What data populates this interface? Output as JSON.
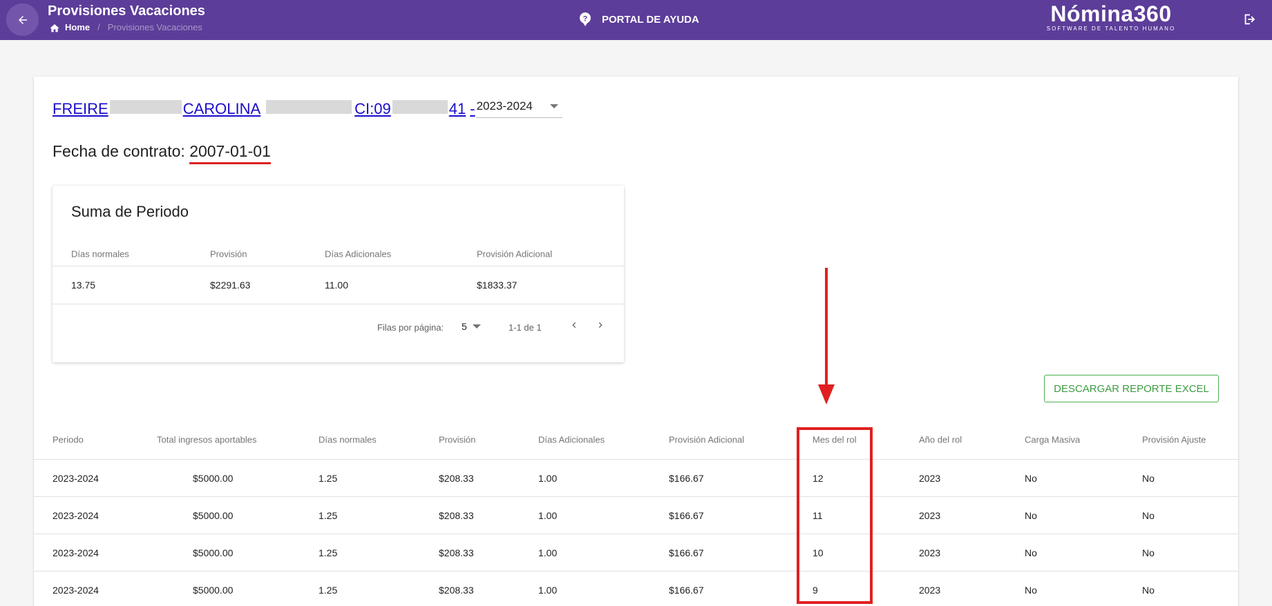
{
  "header": {
    "title": "Provisiones Vacaciones",
    "breadcrumb_home": "Home",
    "breadcrumb_sep": "/",
    "breadcrumb_current": "Provisiones Vacaciones",
    "help_label": "PORTAL DE AYUDA",
    "logo_main": "Nómina360",
    "logo_sub": "SOFTWARE DE TALENTO HUMANO",
    "bg_color": "#5c3d99"
  },
  "employee": {
    "last_name": "FREIRE",
    "first_name": "CAROLINA",
    "ci_prefix": "CI:09",
    "ci_suffix": "41",
    "dash": "-",
    "period_selected": "2023-2024"
  },
  "contract": {
    "label": "Fecha de contrato:",
    "date": "2007-01-01"
  },
  "summary": {
    "title": "Suma de Periodo",
    "columns": [
      "Días normales",
      "Provisión",
      "Días Adicionales",
      "Provisión Adicional"
    ],
    "row": [
      "13.75",
      "$2291.63",
      "11.00",
      "$1833.37"
    ],
    "rows_per_page_label": "Filas por página:",
    "rows_per_page_value": "5",
    "range": "1-1 de 1"
  },
  "excel_button": "DESCARGAR REPORTE EXCEL",
  "table": {
    "columns": [
      "Periodo",
      "Total ingresos aportables",
      "Días normales",
      "Provisión",
      "Días Adicionales",
      "Provisión Adicional",
      "Mes del rol",
      "Año del rol",
      "Carga Masiva",
      "Provisión Ajuste"
    ],
    "rows": [
      [
        "2023-2024",
        "$5000.00",
        "1.25",
        "$208.33",
        "1.00",
        "$166.67",
        "12",
        "2023",
        "No",
        "No"
      ],
      [
        "2023-2024",
        "$5000.00",
        "1.25",
        "$208.33",
        "1.00",
        "$166.67",
        "11",
        "2023",
        "No",
        "No"
      ],
      [
        "2023-2024",
        "$5000.00",
        "1.25",
        "$208.33",
        "1.00",
        "$166.67",
        "10",
        "2023",
        "No",
        "No"
      ],
      [
        "2023-2024",
        "$5000.00",
        "1.25",
        "$208.33",
        "1.00",
        "$166.67",
        "9",
        "2023",
        "No",
        "No"
      ]
    ]
  },
  "icons": {
    "back": "arrow-left-icon",
    "home": "home-icon",
    "help": "help-circle-icon",
    "logout": "logout-icon",
    "dropdown": "caret-down-icon",
    "prev": "chevron-left-icon",
    "next": "chevron-right-icon"
  },
  "colors": {
    "accent": "#5c3d99",
    "link": "#1a0dcc",
    "annotation": "#e02020",
    "excel": "#4caf50"
  }
}
